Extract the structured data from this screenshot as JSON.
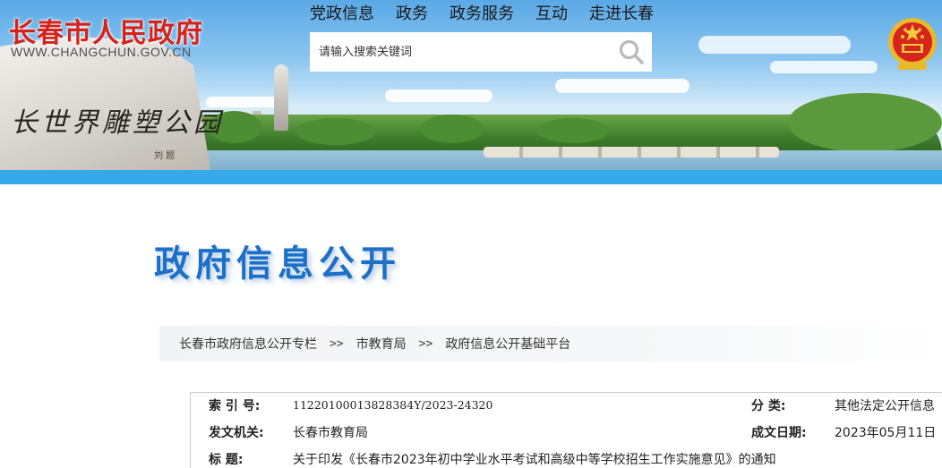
{
  "site": {
    "title": "长春市人民政府",
    "url": "WWW.CHANGCHUN.GOV.CN"
  },
  "nav": {
    "items": [
      "党政信息",
      "政务",
      "政务服务",
      "互动",
      "走进长春"
    ]
  },
  "search": {
    "placeholder": "请输入搜索关键词",
    "icon": "search-icon"
  },
  "banner": {
    "stone_text": "长世界雕塑公园",
    "stone_signature": "刘 题"
  },
  "page": {
    "title": "政府信息公开"
  },
  "breadcrumb": {
    "items": [
      "长春市政府信息公开专栏",
      "市教育局",
      "政府信息公开基础平台"
    ],
    "separator": ">>"
  },
  "info": {
    "index_label": "索 引 号:",
    "index_value": "11220100013828384Y/2023-24320",
    "category_label": "分 类:",
    "category_value": "其他法定公开信息",
    "issuer_label": "发文机关:",
    "issuer_value": "长春市教育局",
    "date_label": "成文日期:",
    "date_value": "2023年05月11日",
    "title_label": "标 题:",
    "title_value": "关于印发《长春市2023年初中学业水平考试和高级中等学校招生工作实施意见》的通知"
  },
  "colors": {
    "brand_red": "#d5231b",
    "accent_blue": "#35a9e9",
    "title_blue": "#1d6fc7"
  }
}
